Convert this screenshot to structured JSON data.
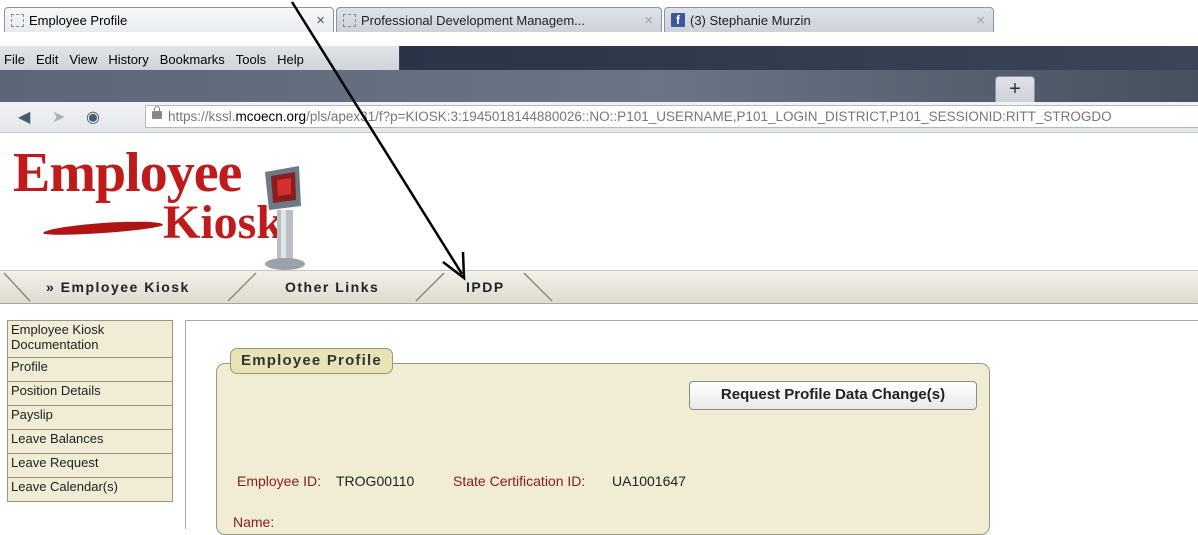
{
  "browser": {
    "menu": [
      "File",
      "Edit",
      "View",
      "History",
      "Bookmarks",
      "Tools",
      "Help"
    ],
    "tabs": [
      {
        "label": "Employee Profile"
      },
      {
        "label": "Professional Development Managem..."
      },
      {
        "label": "(3) Stephanie Murzin"
      }
    ],
    "new_tab_label": "+",
    "url_prefix": "https://kssl.",
    "url_host": "mcoecn.org",
    "url_rest": "/pls/apex31/f?p=KIOSK:3:1945018144880026::NO::P101_USERNAME,P101_LOGIN_DISTRICT,P101_SESSIONID:RITT_STROGDO"
  },
  "logo": {
    "line1": "Employee",
    "line2": "Kiosk"
  },
  "app_tabs": [
    {
      "label": "» Employee Kiosk"
    },
    {
      "label": "Other Links"
    },
    {
      "label": "IPDP"
    }
  ],
  "sidebar": {
    "items": [
      {
        "label": "Employee Kiosk Documentation"
      },
      {
        "label": "Profile"
      },
      {
        "label": "Position Details"
      },
      {
        "label": "Payslip"
      },
      {
        "label": "Leave Balances"
      },
      {
        "label": "Leave Request"
      },
      {
        "label": "Leave Calendar(s)"
      }
    ]
  },
  "profile": {
    "title": "Employee Profile",
    "request_button": "Request Profile Data Change(s)",
    "employee_id_label": "Employee ID:",
    "employee_id": "TROG00110",
    "cert_label": "State Certification ID:",
    "cert_id": "UA1001647",
    "name_label": "Name:"
  },
  "colors": {
    "logo_red": "#c01b1b",
    "label_red": "#8b1a1a",
    "region_bg": "#f0edd4"
  }
}
